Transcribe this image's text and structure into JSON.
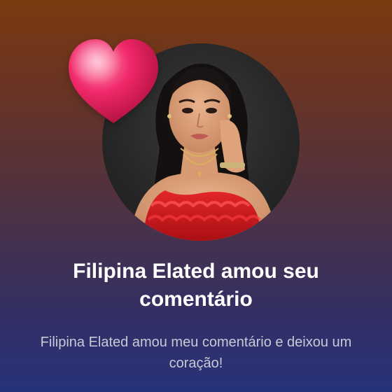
{
  "notification": {
    "title": "Filipina Elated amou seu comentário",
    "message": "Filipina Elated amou meu comentário e deixou um coração!",
    "avatar_alt": "Filipina Elated",
    "reaction_icon": "heart-icon"
  },
  "colors": {
    "background_top": "#7a3a10",
    "background_bottom": "#26337a",
    "heart": "#f0286a",
    "title_text": "#ffffff",
    "message_text": "#c9c9d6"
  }
}
